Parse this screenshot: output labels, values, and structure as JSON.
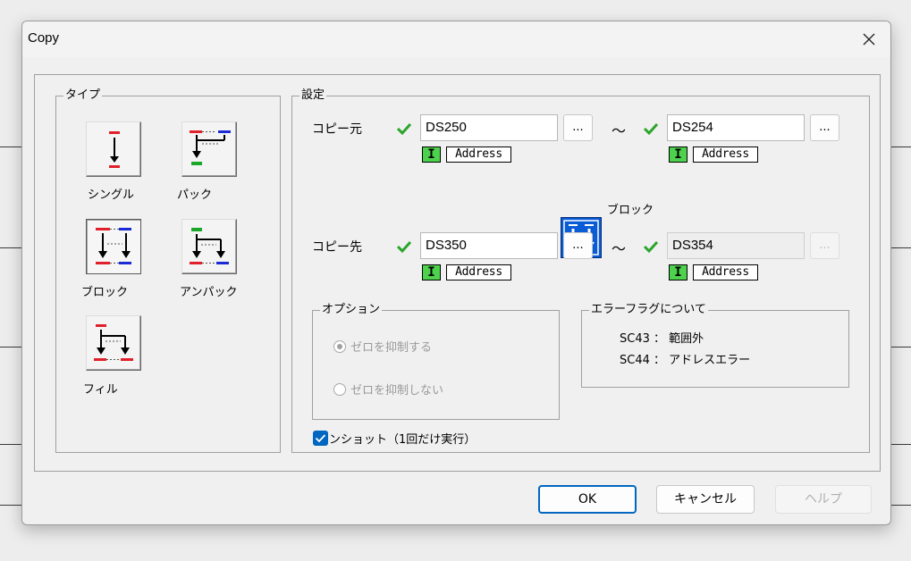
{
  "window": {
    "title": "Copy"
  },
  "type_group": {
    "legend": "タイプ",
    "buttons": [
      {
        "id": "single",
        "label": "シングル",
        "selected": false
      },
      {
        "id": "pack",
        "label": "パック",
        "selected": false
      },
      {
        "id": "block",
        "label": "ブロック",
        "selected": true
      },
      {
        "id": "unpack",
        "label": "アンパック",
        "selected": false
      },
      {
        "id": "fill",
        "label": "フィル",
        "selected": false
      }
    ]
  },
  "settings": {
    "legend": "設定",
    "source": {
      "label": "コピー元",
      "from": {
        "value": "DS250",
        "type_badge": "I",
        "address_label": "Address"
      },
      "to": {
        "value": "DS254",
        "type_badge": "I",
        "address_label": "Address"
      },
      "browse": "...",
      "range_sep": "～"
    },
    "mode_label": "ブロック",
    "dest": {
      "label": "コピー先",
      "from": {
        "value": "DS350",
        "type_badge": "I",
        "address_label": "Address"
      },
      "to": {
        "value": "DS354",
        "type_badge": "I",
        "address_label": "Address",
        "disabled": true
      },
      "browse": "...",
      "range_sep": "～"
    },
    "options": {
      "legend": "オプション",
      "radio1": {
        "label": "ゼロを抑制する",
        "checked": true,
        "disabled": true
      },
      "radio2": {
        "label": "ゼロを抑制しない",
        "checked": false,
        "disabled": true
      }
    },
    "error_flags": {
      "legend": "エラーフラグについて",
      "line1": "SC43 ： 範囲外",
      "line2": "SC44 ： アドレスエラー"
    },
    "oneshot": {
      "label": "ワンショット（1回だけ実行）",
      "checked": true
    }
  },
  "footer": {
    "ok": "OK",
    "cancel": "キャンセル",
    "help": "ヘルプ"
  },
  "colors": {
    "accent": "#0067c0",
    "check_green": "#2aa52a",
    "badge_green": "#4cd24c",
    "block_blue": "#0a5bd6"
  }
}
